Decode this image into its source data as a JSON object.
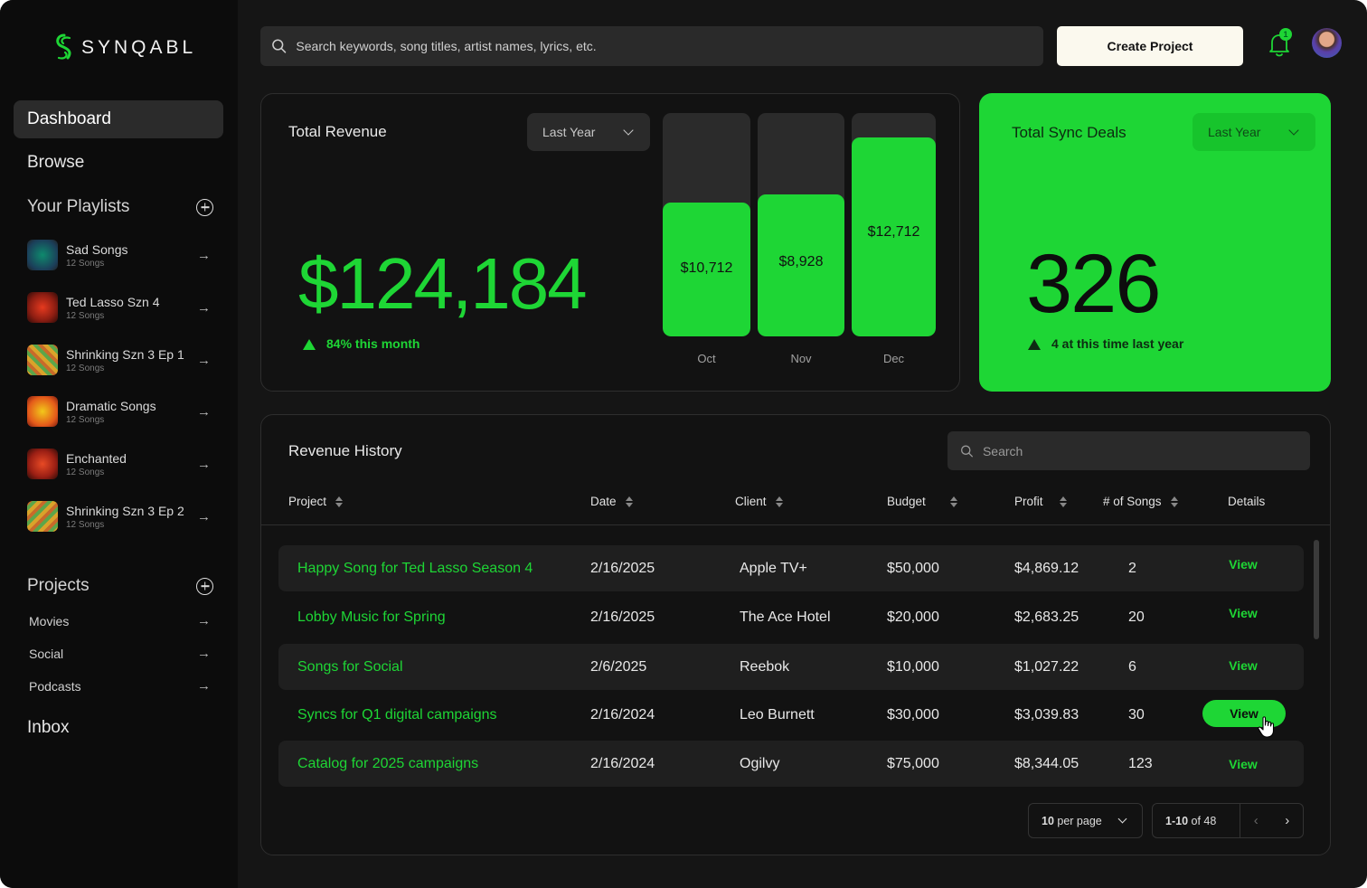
{
  "brand": {
    "name": "SYNQABL",
    "accent": "#1ED635"
  },
  "sidebar": {
    "nav": [
      {
        "label": "Dashboard",
        "active": true
      },
      {
        "label": "Browse",
        "active": false
      }
    ],
    "playlists_heading": "Your Playlists",
    "playlists": [
      {
        "name": "Sad Songs",
        "count": "12 Songs"
      },
      {
        "name": "Ted Lasso Szn 4",
        "count": "12 Songs"
      },
      {
        "name": "Shrinking Szn 3 Ep 1",
        "count": "12 Songs"
      },
      {
        "name": "Dramatic Songs",
        "count": "12 Songs"
      },
      {
        "name": "Enchanted",
        "count": "12 Songs"
      },
      {
        "name": "Shrinking Szn 3 Ep 2",
        "count": "12 Songs"
      }
    ],
    "projects_heading": "Projects",
    "projects": [
      "Movies",
      "Social",
      "Podcasts"
    ],
    "inbox": "Inbox"
  },
  "header": {
    "search_placeholder": "Search keywords, song titles, artist names, lyrics, etc.",
    "create_label": "Create Project",
    "notification_count": "1"
  },
  "revenue": {
    "title": "Total Revenue",
    "period": "Last Year",
    "total": "$124,184",
    "delta": "84% this month",
    "bars": [
      {
        "month": "Oct",
        "label": "$10,712",
        "level": 0.6
      },
      {
        "month": "Nov",
        "label": "$8,928",
        "level": 0.634
      },
      {
        "month": "Dec",
        "label": "$12,712",
        "level": 0.891
      }
    ]
  },
  "sync": {
    "title": "Total Sync Deals",
    "period": "Last Year",
    "total": "326",
    "delta": "4 at this time last year"
  },
  "history": {
    "title": "Revenue History",
    "search_placeholder": "Search",
    "columns": [
      "Project",
      "Date",
      "Client",
      "Budget",
      "Profit",
      "# of Songs",
      "Details"
    ],
    "rows": [
      {
        "project": "Happy Song for Ted Lasso Season 4",
        "date": "2/16/2025",
        "client": "Apple TV+",
        "budget": "$50,000",
        "profit": "$4,869.12",
        "songs": "2",
        "details": "View"
      },
      {
        "project": "Lobby Music for Spring",
        "date": "2/16/2025",
        "client": "The Ace Hotel",
        "budget": "$20,000",
        "profit": "$2,683.25",
        "songs": "20",
        "details": "View"
      },
      {
        "project": "Songs for Social",
        "date": "2/6/2025",
        "client": "Reebok",
        "budget": "$10,000",
        "profit": "$1,027.22",
        "songs": "6",
        "details": "View"
      },
      {
        "project": "Syncs for Q1 digital campaigns",
        "date": "2/16/2024",
        "client": "Leo Burnett",
        "budget": "$30,000",
        "profit": "$3,039.83",
        "songs": "30",
        "details": "View"
      },
      {
        "project": "Catalog for 2025 campaigns",
        "date": "2/16/2024",
        "client": "Ogilvy",
        "budget": "$75,000",
        "profit": "$8,344.05",
        "songs": "123",
        "details": "View"
      }
    ],
    "per_page_value": "10",
    "per_page_suffix": "per page",
    "range": "1-10",
    "range_suffix": "of 48"
  }
}
